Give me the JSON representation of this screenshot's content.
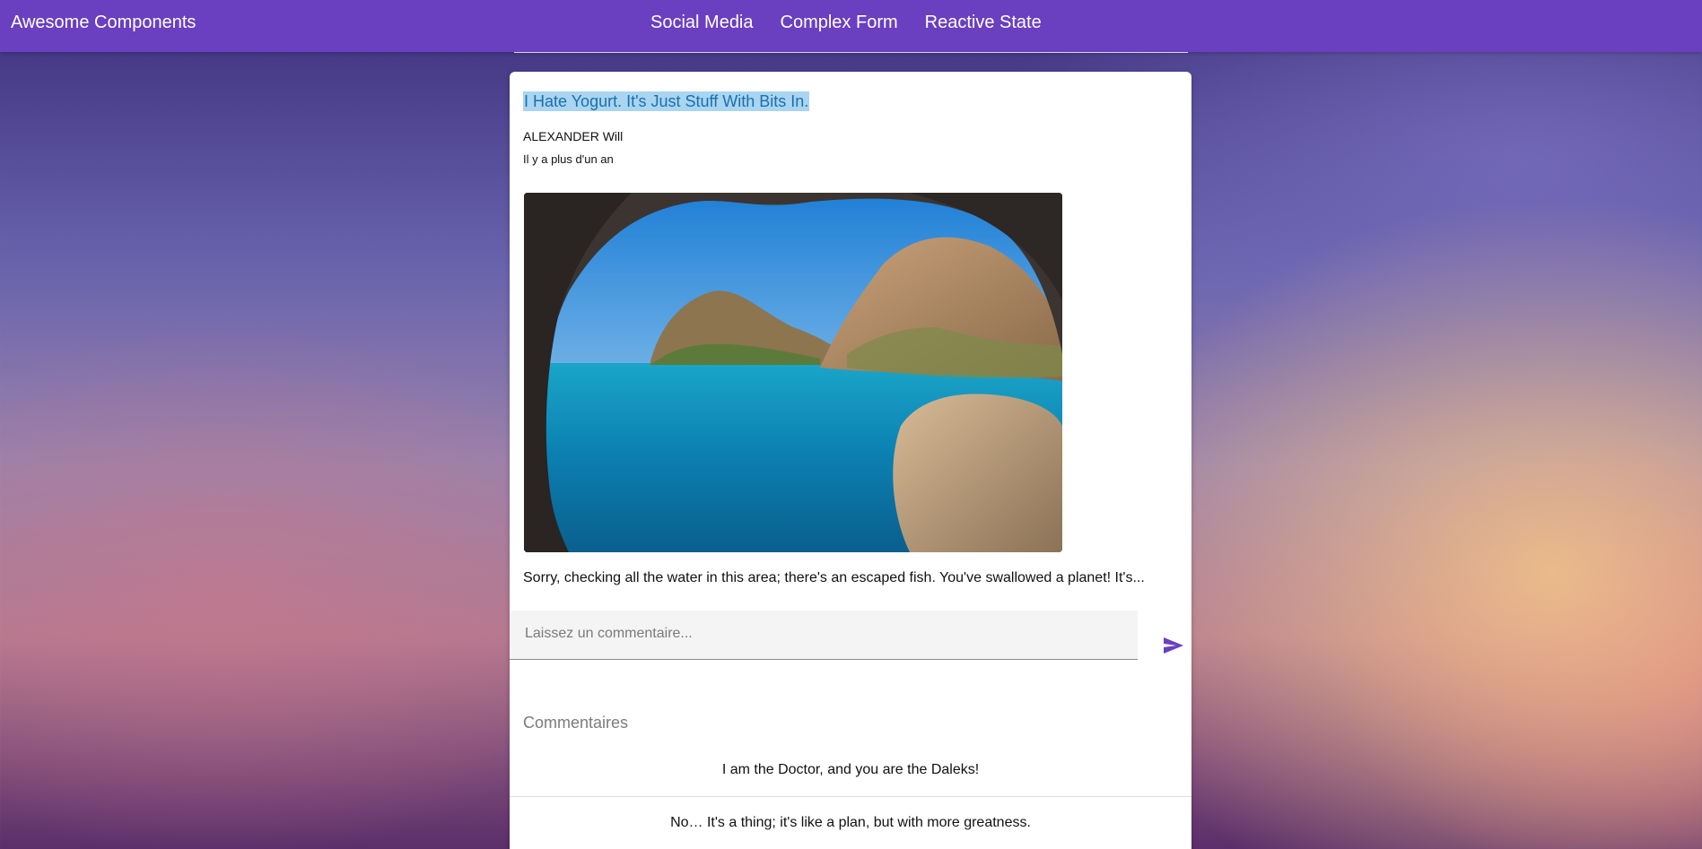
{
  "app": {
    "title": "Awesome Components"
  },
  "nav": {
    "items": [
      {
        "label": "Social Media"
      },
      {
        "label": "Complex Form"
      },
      {
        "label": "Reactive State"
      }
    ]
  },
  "post": {
    "title": "I Hate Yogurt. It's Just Stuff With Bits In.",
    "author": "ALEXANDER Will",
    "date": "Il y a plus d'un an",
    "image_icon": "sea-cave-photo",
    "text": "Sorry, checking all the water in this area; there's an escaped fish. You've swallowed a planet! It's..."
  },
  "comment_form": {
    "placeholder": "Laissez un commentaire...",
    "send_icon": "send-icon",
    "accent_color": "#6a3fc0"
  },
  "comments": {
    "heading": "Commentaires",
    "items": [
      {
        "text": "I am the Doctor, and you are the Daleks!"
      },
      {
        "text": "No… It's a thing; it's like a plan, but with more greatness."
      }
    ]
  },
  "colors": {
    "toolbar": "#6a3fc0",
    "card": "#ffffff",
    "title_link": "#1b6fae"
  }
}
